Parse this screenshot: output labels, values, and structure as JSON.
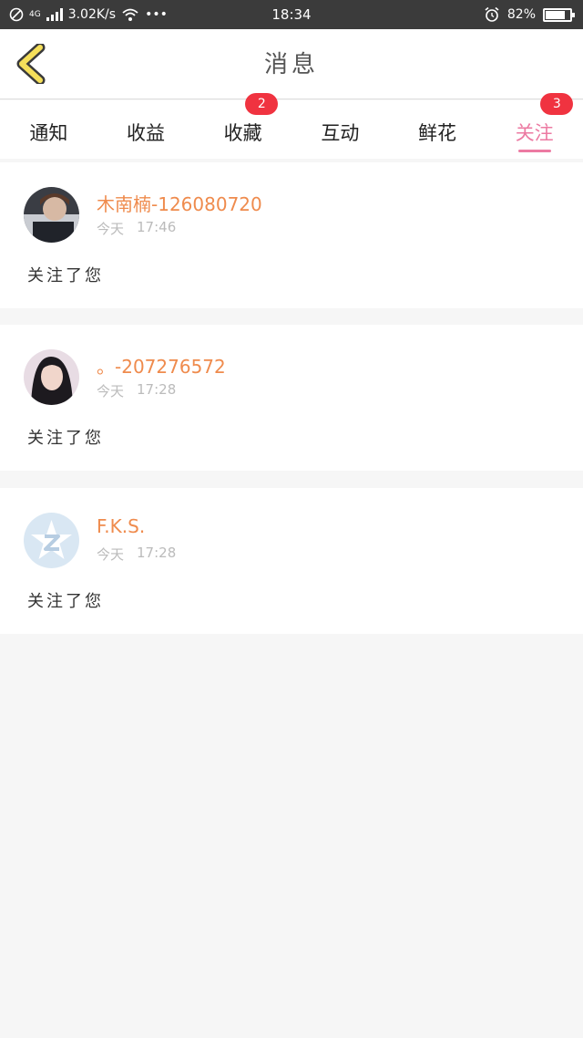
{
  "status_bar": {
    "network": "4G",
    "speed": "3.02K/s",
    "dots": "•••",
    "time": "18:34",
    "battery_percent": "82%",
    "battery_level": 0.82
  },
  "header": {
    "title": "消息"
  },
  "tabs": [
    {
      "label": "通知"
    },
    {
      "label": "收益"
    },
    {
      "label": "收藏",
      "badge": "2"
    },
    {
      "label": "互动"
    },
    {
      "label": "鲜花"
    },
    {
      "label": "关注",
      "badge": "3",
      "active": true
    }
  ],
  "notifications": [
    {
      "name": "木南楠-126080720",
      "date": "今天",
      "time": "17:46",
      "message": "关注了您"
    },
    {
      "name": "。-207276572",
      "date": "今天",
      "time": "17:28",
      "message": "关注了您"
    },
    {
      "name": "F.K.S.",
      "date": "今天",
      "time": "17:28",
      "message": "关注了您"
    }
  ],
  "colors": {
    "accent_pink": "#ec7aa2",
    "badge_red": "#f03340",
    "name_orange": "#ef8b4d",
    "back_arrow_yellow": "#f5df5a"
  }
}
